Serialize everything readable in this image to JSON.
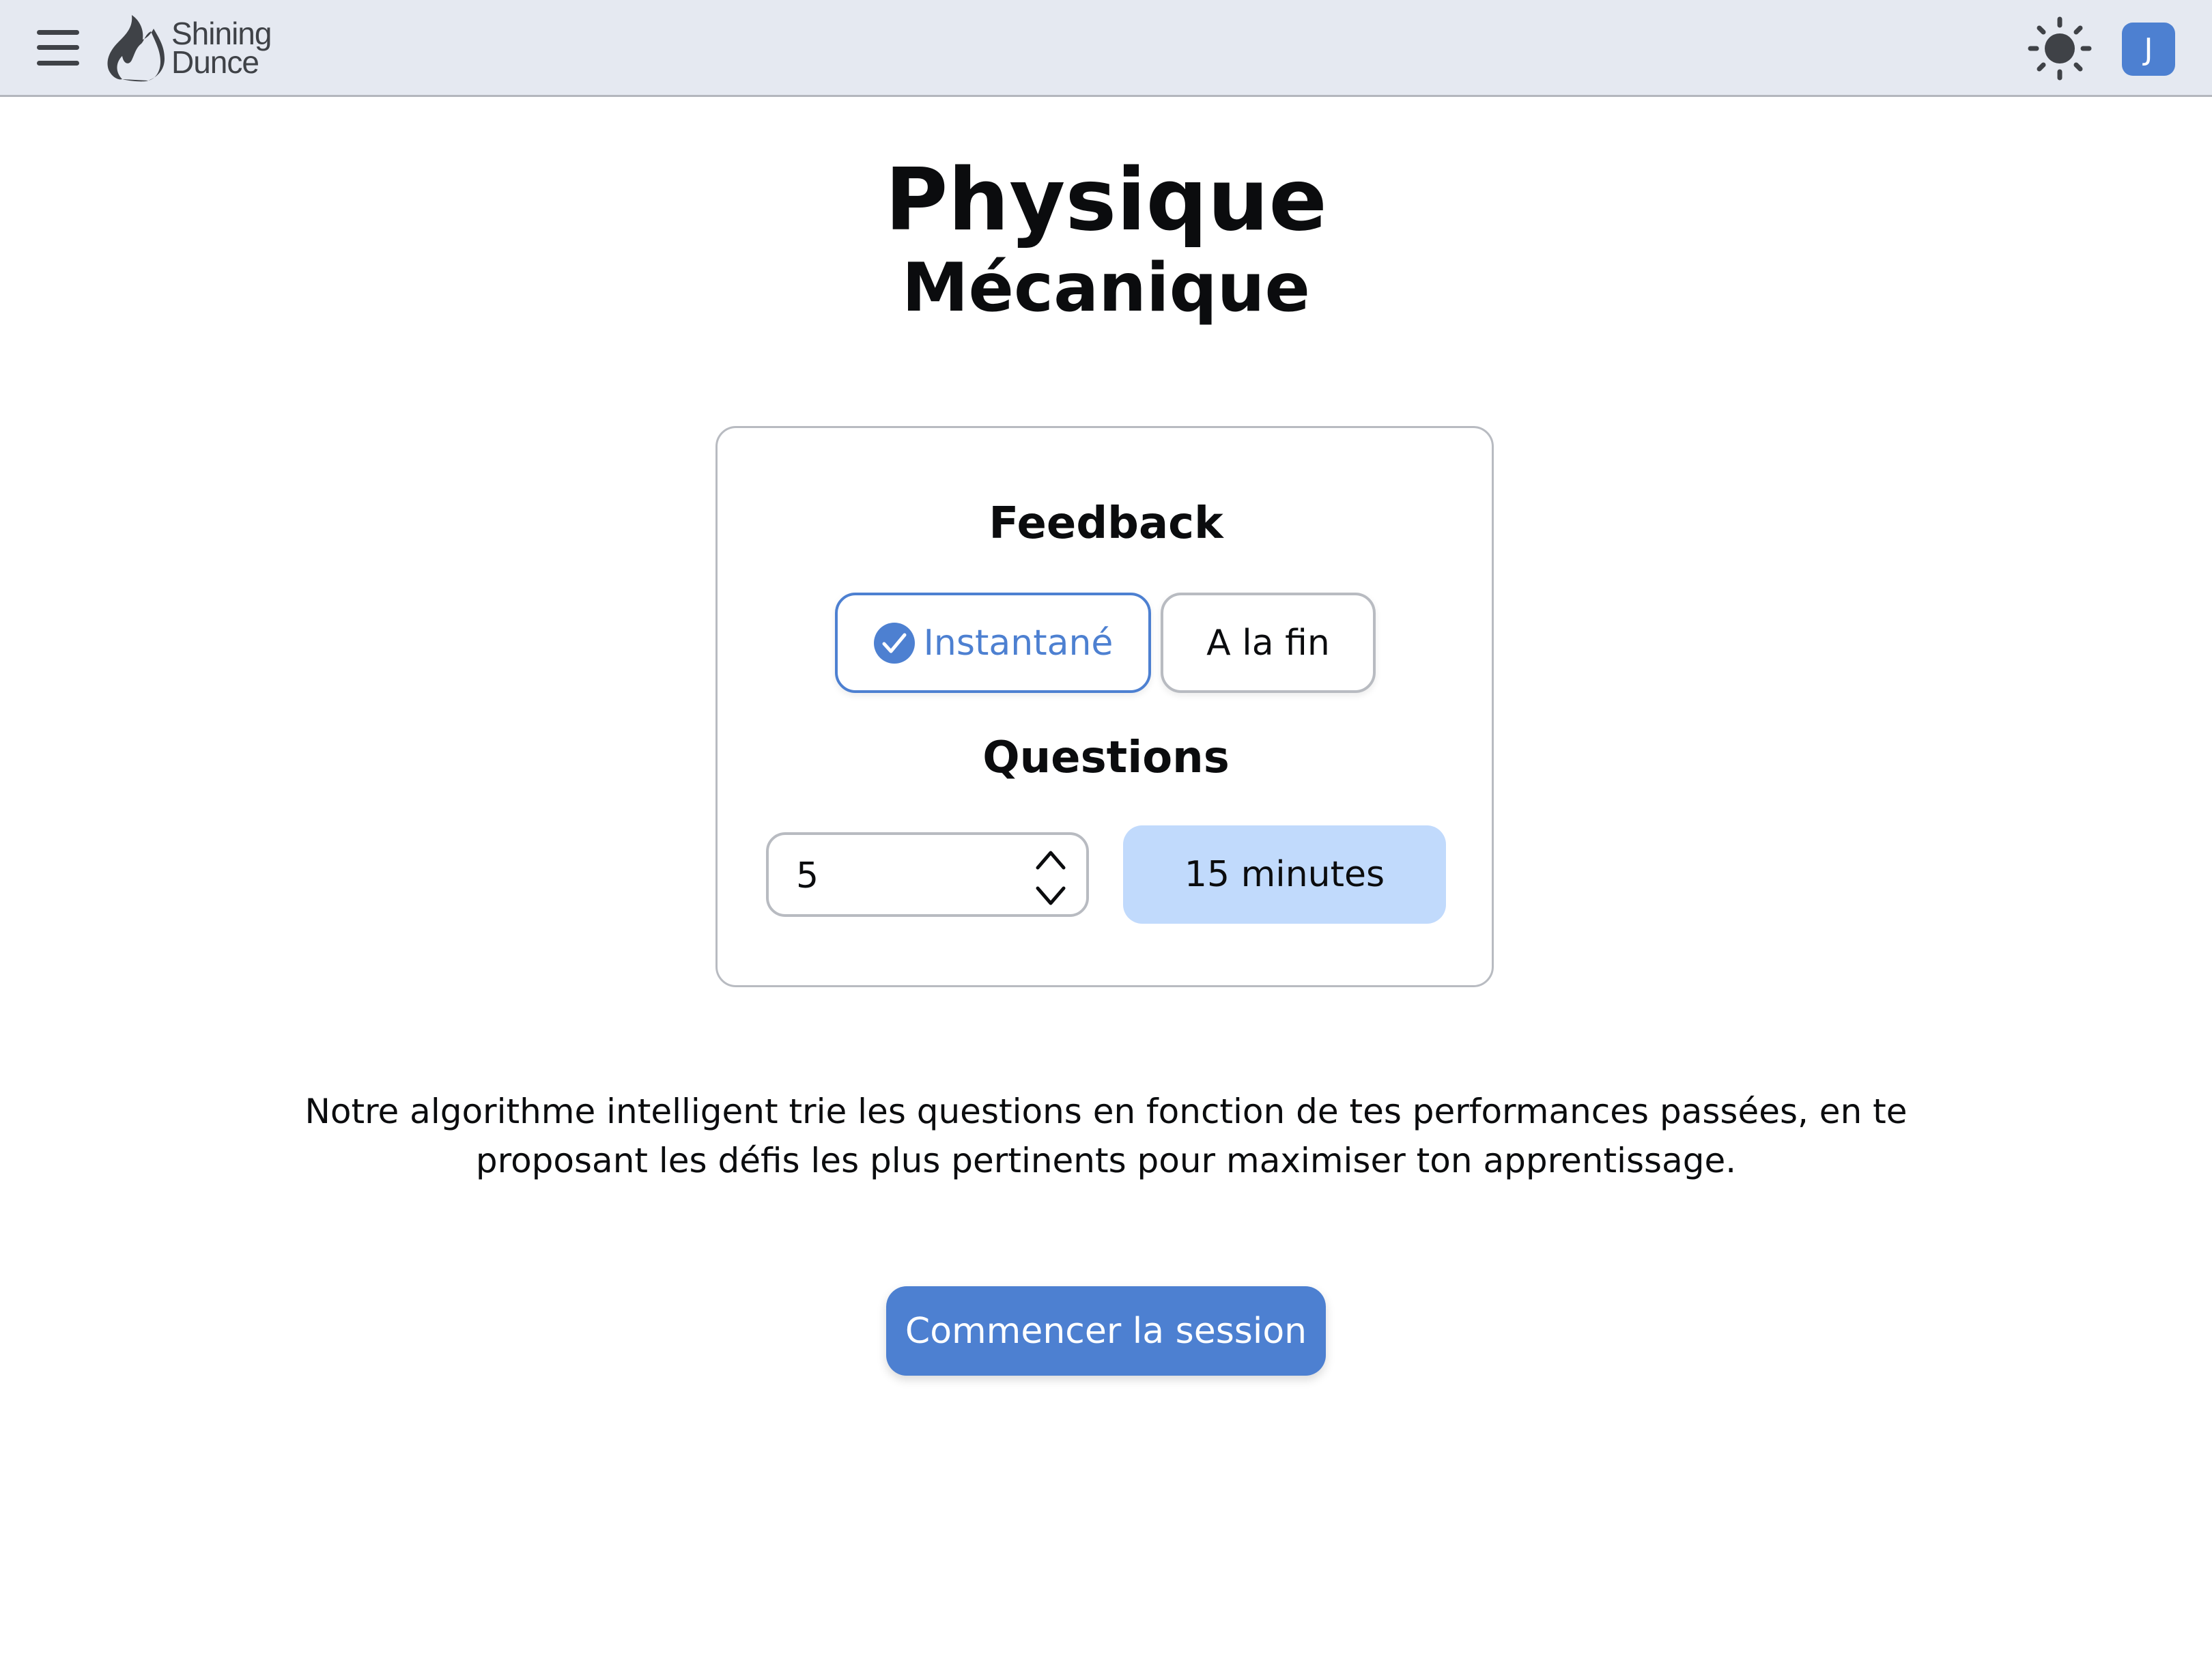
{
  "header": {
    "menu_icon": "hamburger-menu-icon",
    "logo_icon": "flame-icon",
    "logo_line1": "Shining",
    "logo_line2": "Dunce",
    "theme_icon": "sun-icon",
    "avatar_initial": "J"
  },
  "page": {
    "subject": "Physique",
    "topic": "Mécanique"
  },
  "settings": {
    "feedback_label": "Feedback",
    "feedback_options": [
      {
        "label": "Instantané",
        "selected": true,
        "icon": "check-circle-icon"
      },
      {
        "label": "A la fin",
        "selected": false
      }
    ],
    "questions_label": "Questions",
    "questions_count": "5",
    "duration": "15 minutes"
  },
  "description": "Notre algorithme intelligent trie les questions en fonction de tes performances passées, en te proposant les défis les plus pertinents pour maximiser ton apprentissage.",
  "start_button": "Commencer la session",
  "colors": {
    "accent": "#4d80d1",
    "header_bg": "#e5e9f1",
    "duration_bg": "#c1dafc",
    "border": "#b8bbc1",
    "icon_dark": "#3f4247"
  }
}
